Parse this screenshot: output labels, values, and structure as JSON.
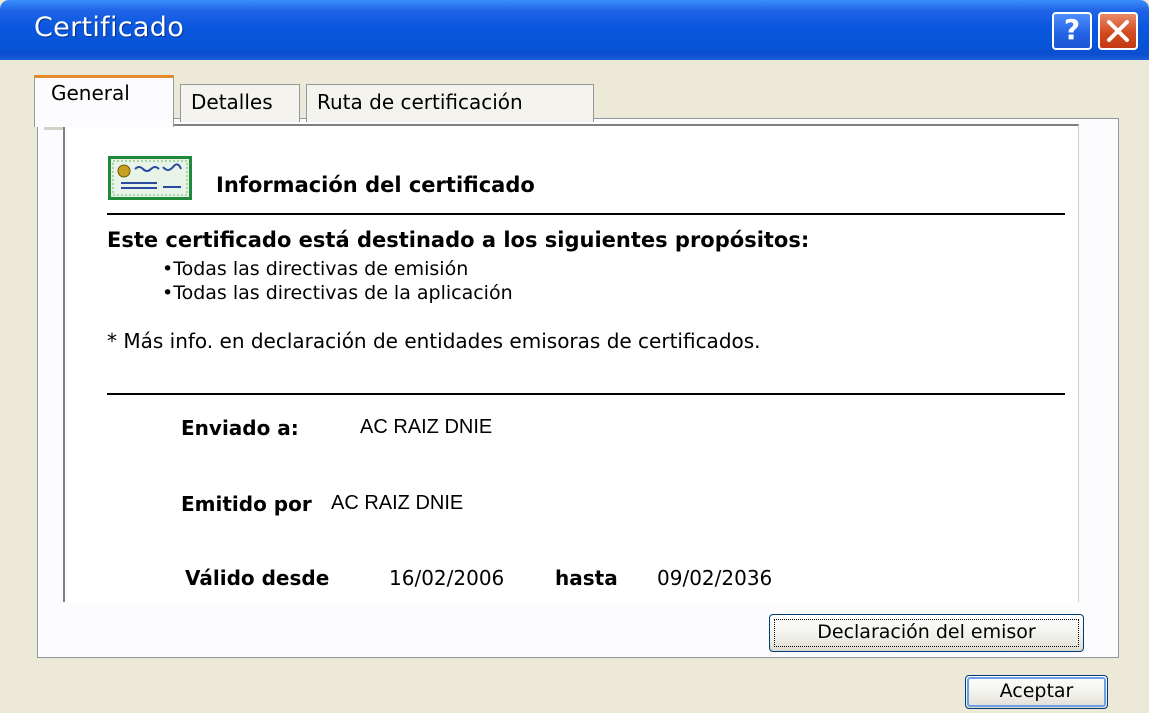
{
  "window": {
    "title": "Certificado",
    "help_label": "?",
    "colors": {
      "titlebar": "#0855d8",
      "close_button": "#d24a1f",
      "face": "#ece9d8",
      "tab_highlight": "#e68b2c"
    }
  },
  "tabs": [
    {
      "label": "General",
      "selected": true
    },
    {
      "label": "Detalles",
      "selected": false
    },
    {
      "label": "Ruta de certificación",
      "selected": false
    }
  ],
  "general": {
    "icon": "certificate-icon",
    "heading": "Información del certificado",
    "purpose_title": "Este certificado está destinado a los siguientes propósitos:",
    "purposes": [
      "•Todas las directivas de emisión",
      "•Todas las directivas de la aplicación"
    ],
    "note": "* Más info. en declaración de entidades emisoras de certificados.",
    "issued_to_label": "Enviado a:",
    "issued_to_value": "AC RAIZ DNIE",
    "issued_by_label": "Emitido por",
    "issued_by_value": "AC RAIZ DNIE",
    "valid_from_label": "Válido desde",
    "valid_from_value": "16/02/2006",
    "valid_to_label": "hasta",
    "valid_to_value": "09/02/2036"
  },
  "buttons": {
    "issuer_statement": "Declaración del emisor",
    "ok": "Aceptar"
  }
}
